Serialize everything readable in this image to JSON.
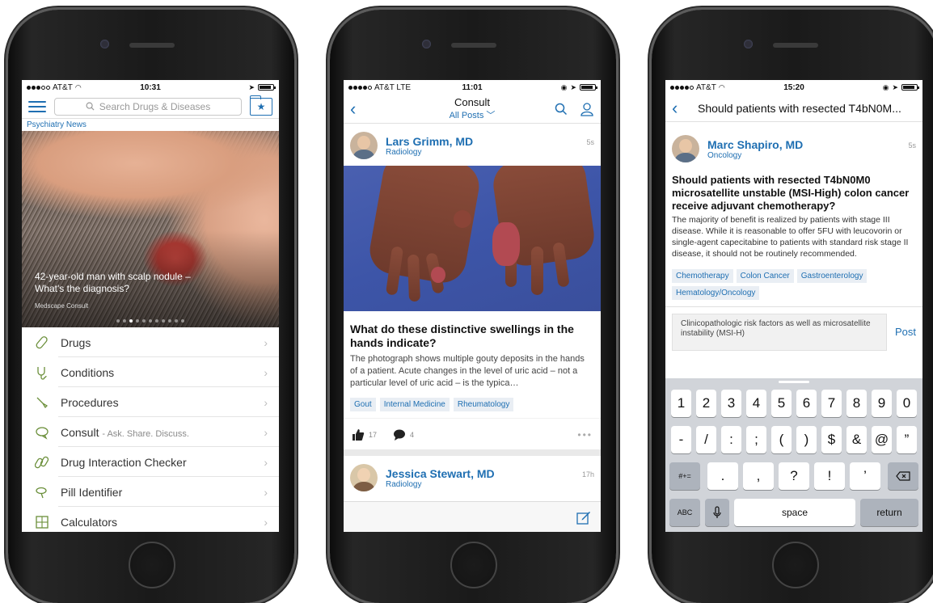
{
  "phone1": {
    "status": {
      "carrier": "AT&T",
      "time": "10:31"
    },
    "search_placeholder": "Search Drugs & Diseases",
    "source_label": "Psychiatry News",
    "hero": {
      "caption": "42-year-old man with scalp nodule – What's the diagnosis?",
      "source": "Medscape Consult"
    },
    "menu": [
      {
        "label": "Drugs",
        "icon": "pill-capsule-icon"
      },
      {
        "label": "Conditions",
        "icon": "stethoscope-icon"
      },
      {
        "label": "Procedures",
        "icon": "scalpel-icon"
      },
      {
        "label": "Consult",
        "sub": "- Ask. Share. Discuss.",
        "icon": "chat-bubble-icon"
      },
      {
        "label": "Drug Interaction Checker",
        "icon": "pills-interaction-icon"
      },
      {
        "label": "Pill Identifier",
        "icon": "pill-identifier-icon"
      },
      {
        "label": "Calculators",
        "icon": "calculator-icon"
      }
    ]
  },
  "phone2": {
    "status": {
      "carrier": "AT&T LTE",
      "time": "11:01"
    },
    "nav": {
      "title": "Consult",
      "filter": "All Posts"
    },
    "post": {
      "author": "Lars Grimm, MD",
      "specialty": "Radiology",
      "time": "5s",
      "title": "What do these distinctive swellings in the hands indicate?",
      "body": "The photograph shows multiple gouty deposits in the hands of a patient. Acute changes in the level of uric acid – not a particular level of uric acid – is the typica…",
      "tags": [
        "Gout",
        "Internal Medicine",
        "Rheumatology"
      ],
      "likes": "17",
      "comments": "4"
    },
    "next_post": {
      "author": "Jessica Stewart, MD",
      "specialty": "Radiology",
      "time": "17h"
    }
  },
  "phone3": {
    "status": {
      "carrier": "AT&T",
      "time": "15:20"
    },
    "nav_title": "Should patients with resected T4bN0M...",
    "post": {
      "author": "Marc Shapiro, MD",
      "specialty": "Oncology",
      "time": "5s",
      "title": "Should patients with resected T4bN0M0 microsatellite unstable (MSI-High) colon cancer receive adjuvant chemotherapy?",
      "body": "The majority of benefit is realized by patients with stage III disease. While it is reasonable to offer 5FU with leucovorin or single-agent capecitabine to patients with standard risk stage II disease, it should not be routinely recommended.",
      "tags": [
        "Chemotherapy",
        "Colon Cancer",
        "Gastroenterology",
        "Hematology/Oncology"
      ]
    },
    "compose": {
      "text": "Clinicopathologic risk factors as well as microsatellite instability (MSI-H)",
      "post_label": "Post"
    },
    "keyboard": {
      "row1": [
        "1",
        "2",
        "3",
        "4",
        "5",
        "6",
        "7",
        "8",
        "9",
        "0"
      ],
      "row2": [
        "-",
        "/",
        ":",
        ";",
        "(",
        ")",
        "$",
        "&",
        "@",
        "”"
      ],
      "row3_left": "#+=",
      "row3": [
        ".",
        ",",
        "?",
        "!",
        "’"
      ],
      "abc": "ABC",
      "space": "space",
      "return": "return"
    }
  },
  "colors": {
    "accent": "#1f6fb2",
    "tag_bg": "#e9eef4",
    "keyboard_bg": "#d1d4d9"
  }
}
